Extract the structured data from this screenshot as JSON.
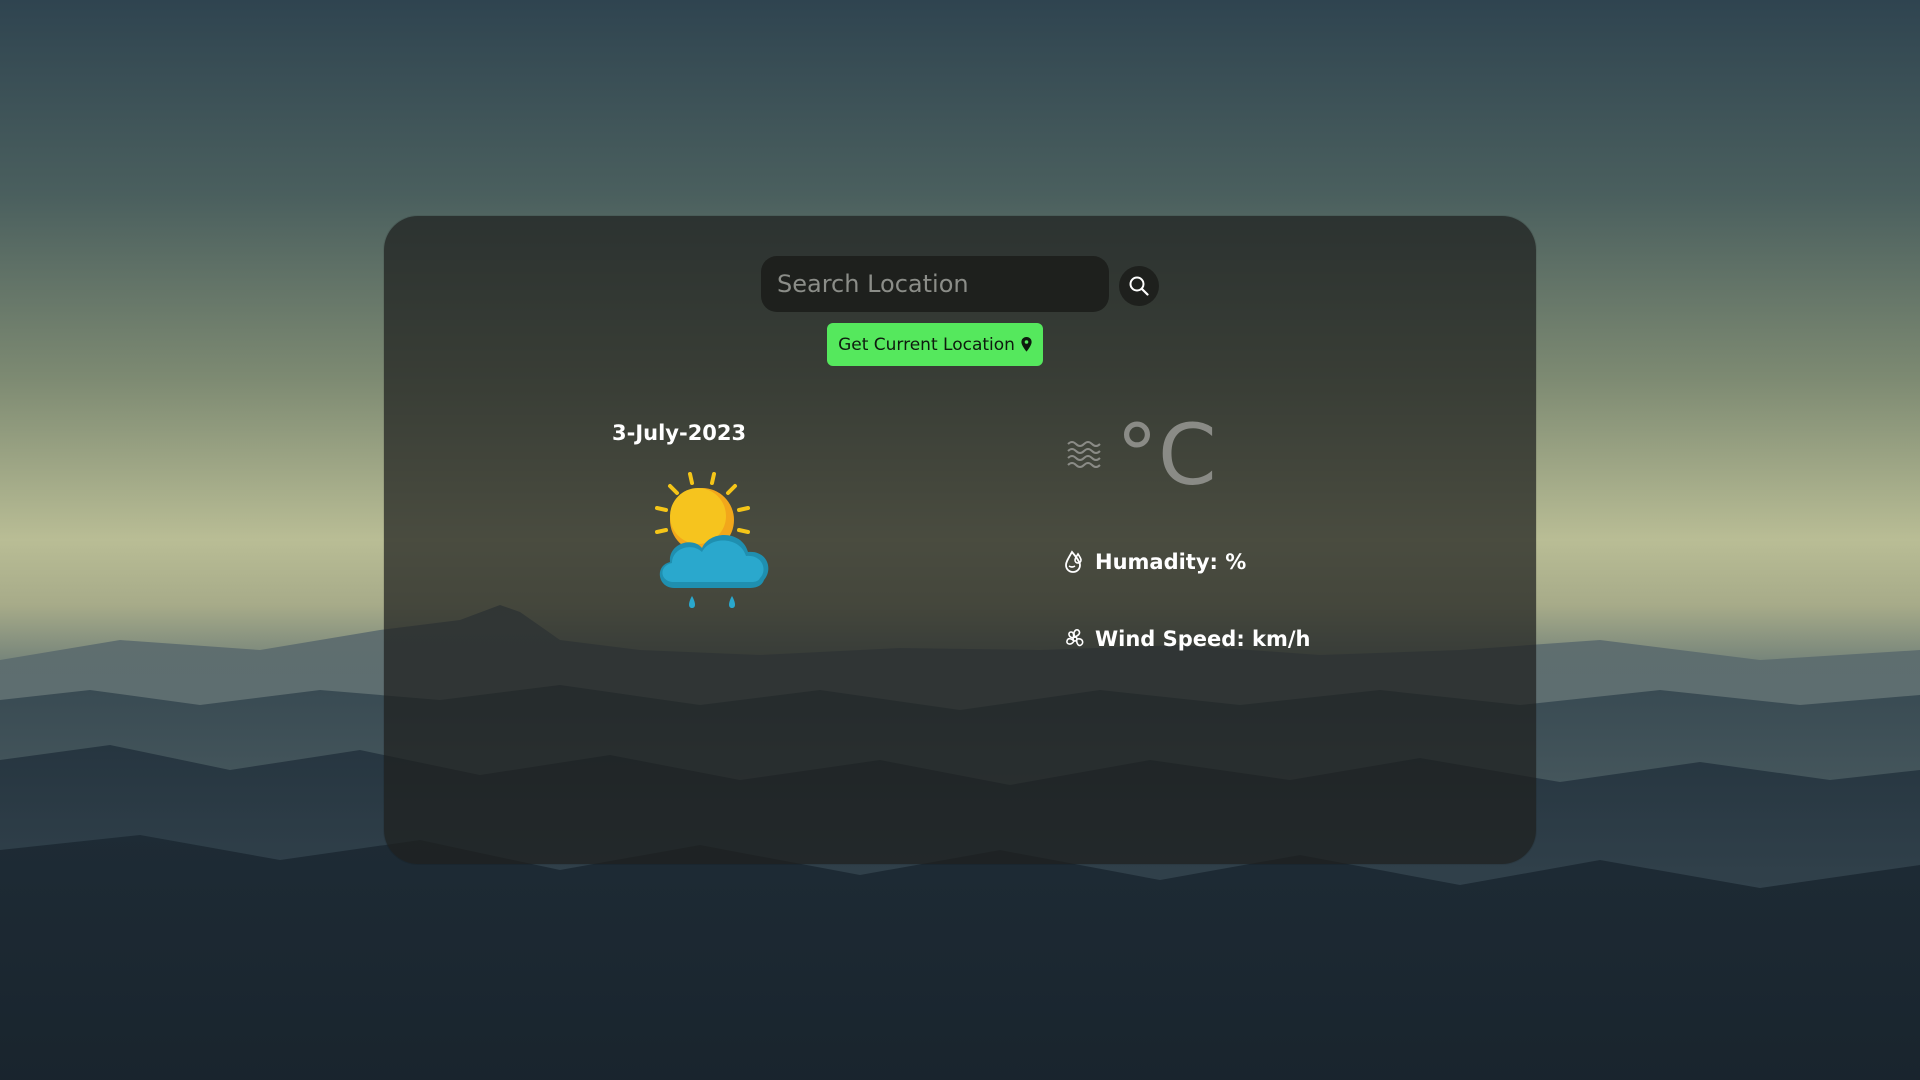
{
  "search": {
    "placeholder": "Search Location",
    "value": ""
  },
  "location_button": {
    "label": "Get Current Location",
    "icon": "map-pin-icon"
  },
  "weather": {
    "date": "3-July-2023",
    "condition_icon": "sun-cloud-rain-icon",
    "temperature_value": "",
    "temperature_unit": "°C",
    "temperature_icon": "haze-waves-icon",
    "humidity_label": "Humadity: %",
    "humidity_icon": "humidity-drop-icon",
    "wind_label": "Wind Speed: km/h",
    "wind_icon": "wind-fan-icon"
  },
  "colors": {
    "accent_button": "#55e85d",
    "card_background": "rgba(30,32,30,0.72)",
    "text_primary": "#ffffff",
    "text_muted": "#8a8b86"
  }
}
